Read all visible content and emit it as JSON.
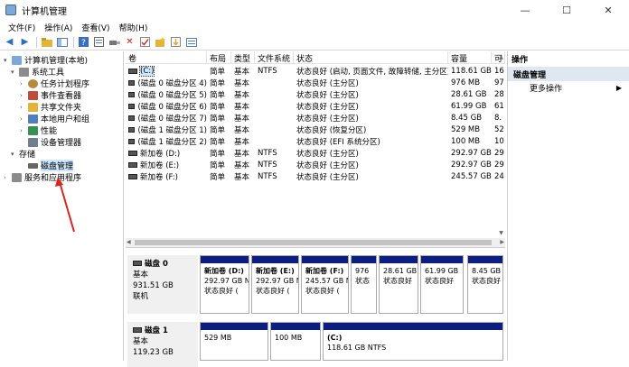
{
  "window": {
    "title": "计算机管理",
    "min": "—",
    "max": "☐",
    "close": "✕"
  },
  "menu": [
    "文件(F)",
    "操作(A)",
    "查看(V)",
    "帮助(H)"
  ],
  "tree": [
    {
      "label": "计算机管理(本地)",
      "level": 0,
      "caret": "▾",
      "color": "#7fa7d8"
    },
    {
      "label": "系统工具",
      "level": 1,
      "caret": "▾",
      "color": "#8c8c8c"
    },
    {
      "label": "任务计划程序",
      "level": 2,
      "caret": "›",
      "color": "#b48a3c"
    },
    {
      "label": "事件查看器",
      "level": 2,
      "caret": "›",
      "color": "#c04d3a"
    },
    {
      "label": "共享文件夹",
      "level": 2,
      "caret": "›",
      "color": "#e3b43c"
    },
    {
      "label": "本地用户和组",
      "level": 2,
      "caret": "›",
      "color": "#4f7fbf"
    },
    {
      "label": "性能",
      "level": 2,
      "caret": "›",
      "color": "#3a8f52"
    },
    {
      "label": "设备管理器",
      "level": 2,
      "caret": "",
      "color": "#6f7f8f"
    },
    {
      "label": "存储",
      "level": 1,
      "caret": "▾",
      "color": "#8c8c8c"
    },
    {
      "label": "磁盘管理",
      "level": 2,
      "caret": "",
      "color": "#666666"
    },
    {
      "label": "服务和应用程序",
      "level": 1,
      "caret": "›",
      "color": "#8c8c8c"
    }
  ],
  "volumes": {
    "headers": [
      "卷",
      "布局",
      "类型",
      "文件系统",
      "状态",
      "容量",
      "可"
    ],
    "rows": [
      [
        "(C:)",
        "简单",
        "基本",
        "NTFS",
        "状态良好 (启动, 页面文件, 故障转储, 主分区)",
        "118.61 GB",
        "16"
      ],
      [
        "(磁盘 0 磁盘分区 4)",
        "简单",
        "基本",
        "",
        "状态良好 (主分区)",
        "976 MB",
        "97"
      ],
      [
        "(磁盘 0 磁盘分区 5)",
        "简单",
        "基本",
        "",
        "状态良好 (主分区)",
        "28.61 GB",
        "28"
      ],
      [
        "(磁盘 0 磁盘分区 6)",
        "简单",
        "基本",
        "",
        "状态良好 (主分区)",
        "61.99 GB",
        "61"
      ],
      [
        "(磁盘 0 磁盘分区 7)",
        "简单",
        "基本",
        "",
        "状态良好 (主分区)",
        "8.45 GB",
        "8."
      ],
      [
        "(磁盘 1 磁盘分区 1)",
        "简单",
        "基本",
        "",
        "状态良好 (恢复分区)",
        "529 MB",
        "52"
      ],
      [
        "(磁盘 1 磁盘分区 2)",
        "简单",
        "基本",
        "",
        "状态良好 (EFI 系统分区)",
        "100 MB",
        "10"
      ],
      [
        "新加卷 (D:)",
        "简单",
        "基本",
        "NTFS",
        "状态良好 (主分区)",
        "292.97 GB",
        "29"
      ],
      [
        "新加卷 (E:)",
        "简单",
        "基本",
        "NTFS",
        "状态良好 (主分区)",
        "292.97 GB",
        "29"
      ],
      [
        "新加卷 (F:)",
        "简单",
        "基本",
        "NTFS",
        "状态良好 (主分区)",
        "245.57 GB",
        "24"
      ]
    ]
  },
  "disks": [
    {
      "name": "磁盘 0",
      "type": "基本",
      "size": "931.51 GB",
      "status": "联机",
      "parts": [
        {
          "title": "新加卷 (D:)",
          "size": "292.97 GB N",
          "status": "状态良好 (",
          "color": "#0c1f80"
        },
        {
          "title": "新加卷 (E:)",
          "size": "292.97 GB N",
          "status": "状态良好 (",
          "color": "#0c1f80"
        },
        {
          "title": "新加卷 (F:)",
          "size": "245.57 GB N",
          "status": "状态良好 (",
          "color": "#0c1f80"
        },
        {
          "title": "",
          "size": "976",
          "status": "状态",
          "color": "#0c1f80"
        },
        {
          "title": "",
          "size": "28.61 GB",
          "status": "状态良好",
          "color": "#0c1f80"
        },
        {
          "title": "",
          "size": "61.99 GB",
          "status": "状态良好",
          "color": "#0c1f80"
        },
        {
          "title": "",
          "size": "8.45 GB",
          "status": "状态良好",
          "color": "#0c1f80"
        }
      ]
    },
    {
      "name": "磁盘 1",
      "type": "基本",
      "size": "119.23 GB",
      "status": "",
      "parts": [
        {
          "title": "",
          "size": "529 MB",
          "status": "",
          "color": "#0c1f80"
        },
        {
          "title": "",
          "size": "100 MB",
          "status": "",
          "color": "#0c1f80"
        },
        {
          "title": "(C:)",
          "size": "118.61 GB NTFS",
          "status": "",
          "color": "#0c1f80"
        }
      ]
    }
  ],
  "actions": {
    "header": "操作",
    "section": "磁盘管理",
    "more": "更多操作",
    "more_arrow": "▶"
  },
  "colors": {
    "selection": "#cce8ff",
    "partition_bar": "#0c1f80",
    "arrow": "#d7261e"
  }
}
